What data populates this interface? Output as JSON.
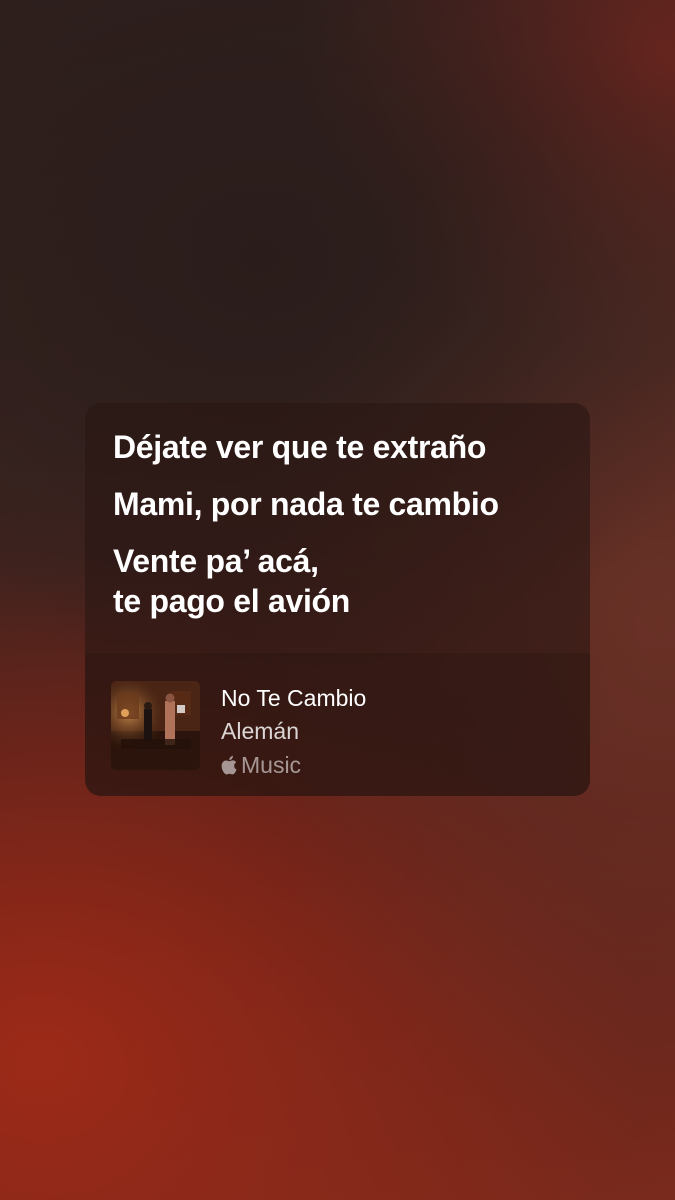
{
  "lyrics": [
    "Déjate ver que te extraño",
    "Mami, por nada te cambio",
    "Vente pa’ acá,\nte pago el avión"
  ],
  "track": {
    "title": "No Te Cambio",
    "artist": "Alemán",
    "service_label": "Music",
    "service_icon": "apple-logo-icon",
    "album_art_icon": "album-art"
  },
  "colors": {
    "card_background": "#2a1614",
    "text_primary": "#ffffff",
    "background_accent": "#a02a18"
  }
}
